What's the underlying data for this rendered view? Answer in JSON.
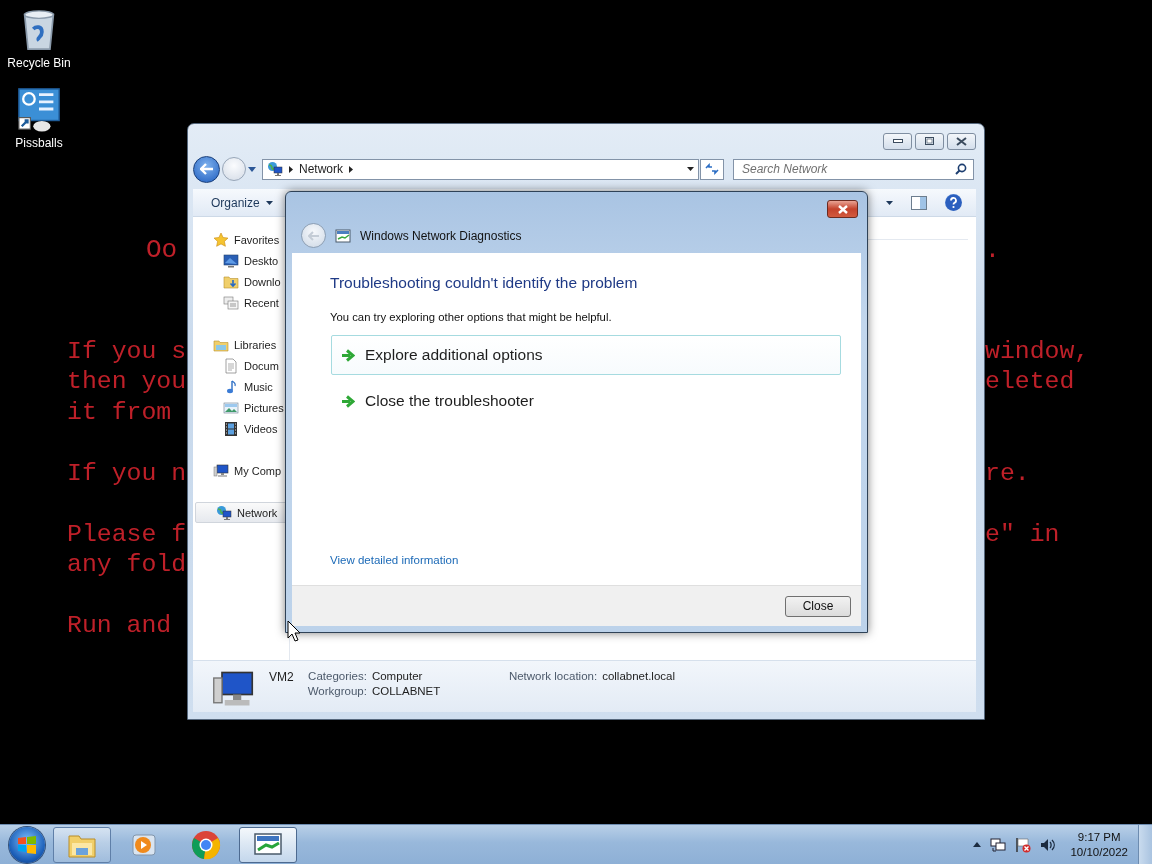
{
  "desktop": {
    "icons": [
      {
        "kind": "bin",
        "label": "Recycle Bin"
      },
      {
        "kind": "app",
        "label": "Pissballs"
      }
    ],
    "background_message": {
      "heading": {
        "left": "Oo",
        "right": "."
      },
      "paragraphs": [
        [
          {
            "left": "If you s",
            "right": "window,"
          },
          {
            "left": "then you",
            "right": "eleted"
          },
          {
            "left": "it from"
          }
        ],
        [
          {
            "left": "If you n",
            "right": "re."
          }
        ],
        [
          {
            "left": "Please f",
            "right": "e\" in"
          },
          {
            "left": "any fold"
          }
        ],
        [
          {
            "left": "Run and"
          }
        ]
      ]
    }
  },
  "explorer": {
    "address": {
      "path": "Network"
    },
    "search": {
      "placeholder": "Search Network"
    },
    "toolbar": {
      "organize": "Organize"
    },
    "sidebar": [
      {
        "kind": "star",
        "label": "Favorites",
        "selected": false,
        "children": [
          {
            "kind": "desktop",
            "label": "Deskto",
            "selected": false
          },
          {
            "kind": "downloads",
            "label": "Downlo",
            "selected": false
          },
          {
            "kind": "recent",
            "label": "Recent",
            "selected": false
          }
        ]
      },
      {
        "kind": "library",
        "label": "Libraries",
        "selected": false,
        "children": [
          {
            "kind": "document",
            "label": "Docum",
            "selected": false
          },
          {
            "kind": "music",
            "label": "Music",
            "selected": false
          },
          {
            "kind": "pictures",
            "label": "Pictures",
            "selected": false
          },
          {
            "kind": "videos",
            "label": "Videos",
            "selected": false
          }
        ]
      },
      {
        "kind": "computer",
        "label": "My Comp",
        "selected": false
      },
      {
        "kind": "network",
        "label": "Network",
        "selected": true
      }
    ],
    "details": {
      "name": "VM2",
      "fields": [
        {
          "label": "Categories:",
          "value": "Computer"
        },
        {
          "label": "Workgroup:",
          "value": "COLLABNET"
        },
        {
          "label": "Network location:",
          "value": "collabnet.local"
        }
      ]
    }
  },
  "dialog": {
    "title": "Windows Network Diagnostics",
    "heading": "Troubleshooting couldn't identify the problem",
    "message": "You can try exploring other options that might be helpful.",
    "options": [
      {
        "label": "Explore additional options",
        "highlighted": true
      },
      {
        "label": "Close the troubleshooter",
        "highlighted": false
      }
    ],
    "link": "View detailed information",
    "button": "Close"
  },
  "taskbar": {
    "buttons": [
      {
        "kind": "explorer",
        "running": true,
        "selected": false
      },
      {
        "kind": "media",
        "running": false,
        "selected": false
      },
      {
        "kind": "browser",
        "running": false,
        "selected": false
      },
      {
        "kind": "diagnostics",
        "running": true,
        "selected": true
      }
    ],
    "clock": {
      "time": "9:17 PM",
      "date": "10/10/2022"
    }
  }
}
